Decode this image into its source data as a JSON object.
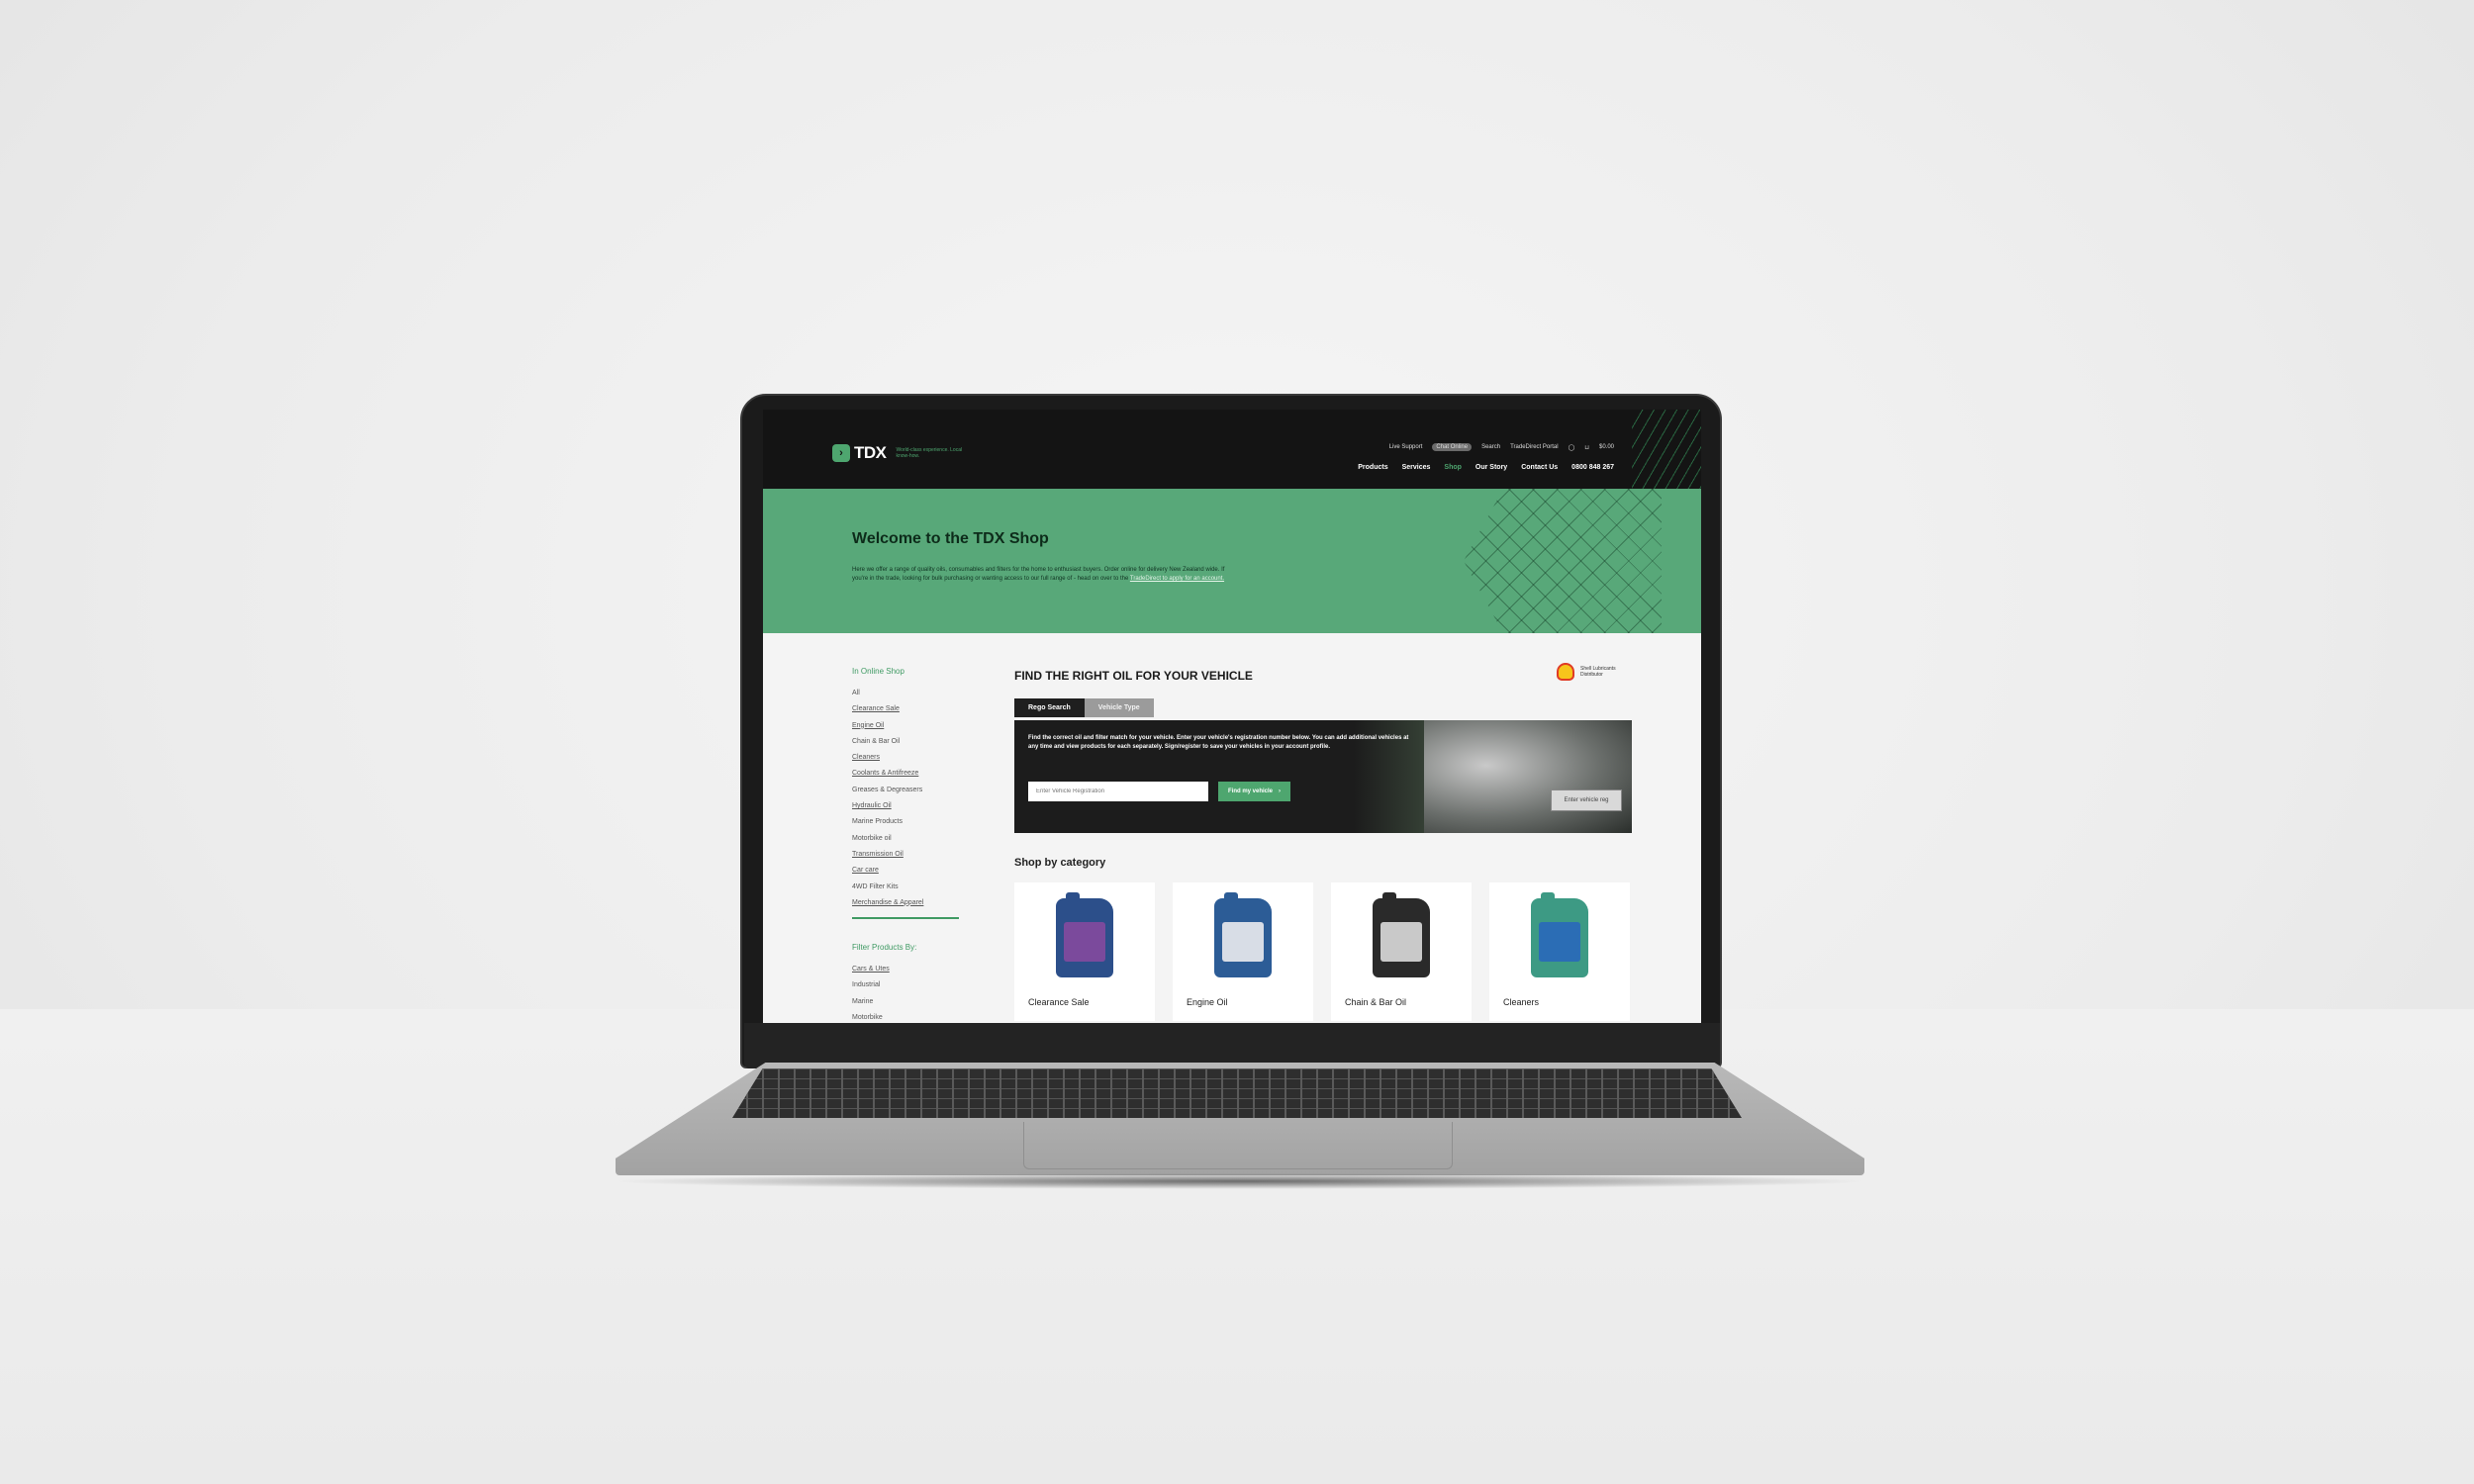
{
  "header": {
    "logo_text": "TDX",
    "logo_tagline": "World-class experience. Local know-how.",
    "utility": {
      "live_support": "Live Support",
      "live_support_badge": "Chat Online",
      "search": "Search",
      "portal": "TradeDirect Portal",
      "cart_total": "$0.00"
    },
    "nav": [
      "Products",
      "Services",
      "Shop",
      "Our Story",
      "Contact Us"
    ],
    "phone": "0800 848 267"
  },
  "hero": {
    "title": "Welcome to the TDX Shop",
    "text": "Here we offer a range of quality oils, consumables and filters for the home to enthusiast buyers. Order online for delivery New Zealand wide. If you're in the trade, looking for bulk purchasing or wanting access to our full range of - head on over to the",
    "link_text": "TradeDirect to apply for an account."
  },
  "sidebar": {
    "heading": "In Online Shop",
    "items": [
      "All",
      "Clearance Sale",
      "Engine Oil",
      "Chain & Bar Oil",
      "Cleaners",
      "Coolants & Antifreeze",
      "Greases & Degreasers",
      "Hydraulic Oil",
      "Marine Products",
      "Motorbike oil",
      "Transmission Oil",
      "Car care",
      "4WD Filter Kits",
      "Merchandise & Apparel"
    ],
    "filter_heading": "Filter Products By:",
    "filter_items": [
      "Cars & Utes",
      "Industrial",
      "Marine",
      "Motorbike"
    ]
  },
  "finder": {
    "title": "FIND THE RIGHT OIL FOR YOUR VEHICLE",
    "partner_text": "Shell Lubricants Distributor",
    "tabs": [
      "Rego Search",
      "Vehicle Type"
    ],
    "description": "Find the correct oil and filter match for your vehicle. Enter your vehicle's registration number below. You can add additional vehicles at any time and view products for each separately. Sign/register to save your vehicles in your account profile.",
    "input_placeholder": "Enter Vehicle Registration",
    "button_label": "Find my vehicle",
    "plate_text": "Enter vehicle reg"
  },
  "categories": {
    "title": "Shop by category",
    "items": [
      {
        "name": "Clearance Sale",
        "color": "#2c4f8a",
        "label_color": "#7b4a9c"
      },
      {
        "name": "Engine Oil",
        "color": "#2c5c96",
        "label_color": "#d8dde6"
      },
      {
        "name": "Chain & Bar Oil",
        "color": "#2a2a2a",
        "label_color": "#c9c9c9"
      },
      {
        "name": "Cleaners",
        "color": "#3d9a84",
        "label_color": "#2b6db5"
      }
    ]
  },
  "colors": {
    "brand_green": "#4ea66f",
    "hero_green": "#58a879",
    "dark": "#141414"
  }
}
